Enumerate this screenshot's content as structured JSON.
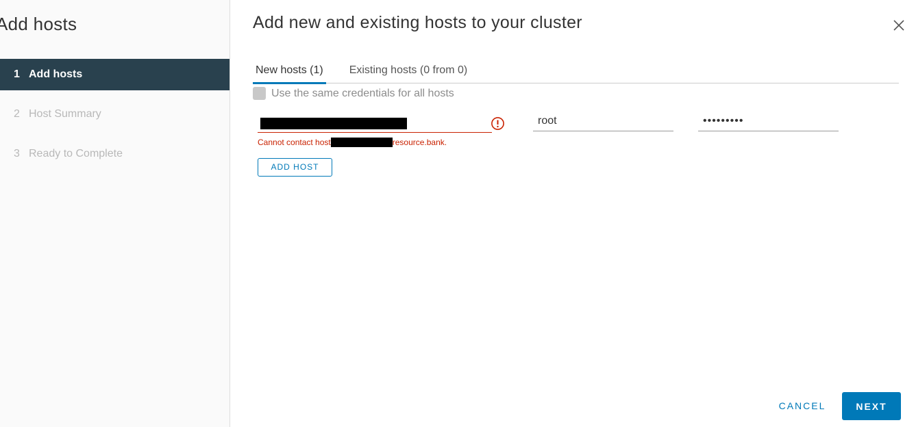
{
  "sidebar": {
    "title": "Add hosts",
    "steps": [
      {
        "number": "1",
        "label": "Add hosts",
        "state": "active"
      },
      {
        "number": "2",
        "label": "Host Summary",
        "state": "disabled"
      },
      {
        "number": "3",
        "label": "Ready to Complete",
        "state": "disabled"
      }
    ]
  },
  "main": {
    "title": "Add new and existing hosts to your cluster",
    "close_icon": "close-icon",
    "tabs": [
      {
        "label": "New hosts (1)",
        "active": true
      },
      {
        "label": "Existing hosts (0 from 0)",
        "active": false
      }
    ],
    "same_credentials": {
      "label": "Use the same credentials for all hosts",
      "checked": false,
      "disabled": true
    },
    "host_row": {
      "username": "root",
      "password": "•••••••••",
      "error_prefix": "Cannot contact host",
      "error_suffix": "resource.bank.",
      "error_icon": "alert-circle-icon"
    },
    "add_host_label": "ADD HOST",
    "cancel_label": "CANCEL",
    "next_label": "NEXT"
  },
  "colors": {
    "accent": "#0079b8",
    "error": "#c92100",
    "sidebar_active": "#29414e"
  }
}
